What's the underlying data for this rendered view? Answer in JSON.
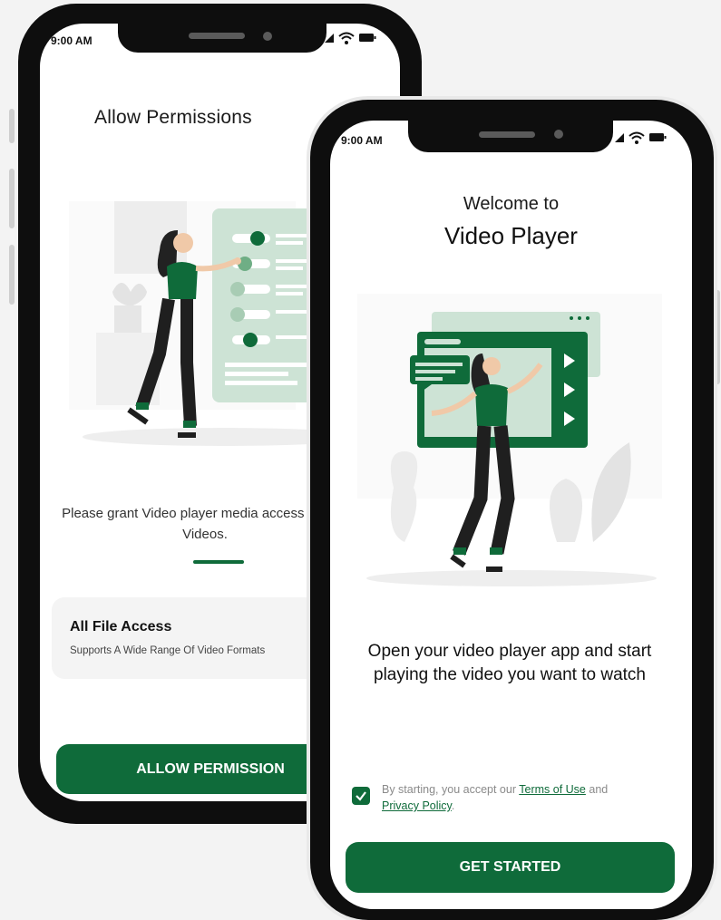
{
  "colors": {
    "accent": "#0f6b3a",
    "background": "#f3f3f3"
  },
  "permissions_screen": {
    "time": "9:00 AM",
    "title": "Allow Permissions",
    "description": "Please grant Video player media access to play Videos.",
    "card": {
      "title": "All File Access",
      "subtitle": "Supports A Wide Range Of Video Formats"
    },
    "button_label": "ALLOW PERMISSION",
    "icons": [
      "signal-icon",
      "wifi-icon",
      "battery-icon"
    ]
  },
  "welcome_screen": {
    "time": "9:00 AM",
    "welcome": "Welcome to",
    "title": "Video Player",
    "description": "Open your video player app and start playing the video you want to watch",
    "terms": {
      "checked": true,
      "prefix": "By starting, you accept our",
      "terms_link": "Terms of Use",
      "and": "and",
      "privacy_link": "Privacy Policy",
      "suffix": "."
    },
    "button_label": "GET STARTED",
    "icons": [
      "signal-icon",
      "wifi-icon",
      "battery-icon"
    ]
  }
}
